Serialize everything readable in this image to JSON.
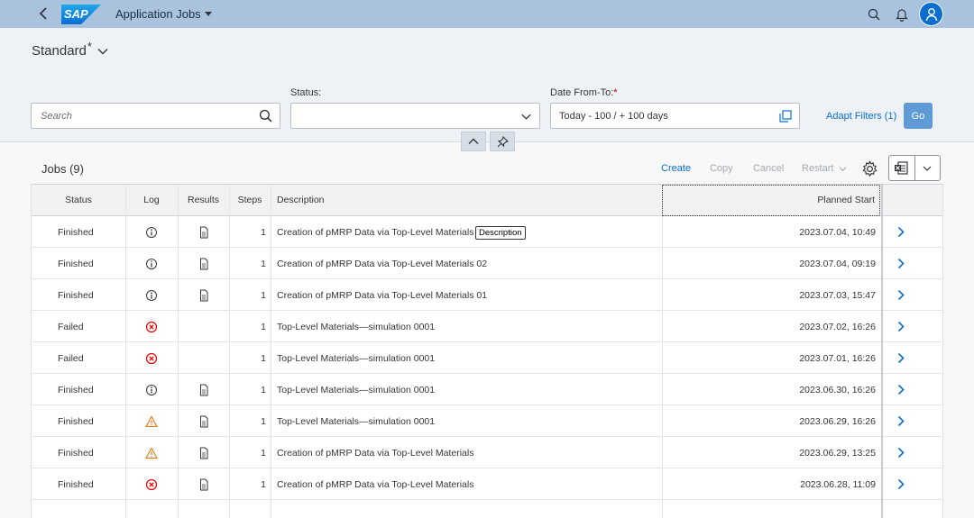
{
  "shell": {
    "app_title": "Application Jobs",
    "logo_text": "SAP"
  },
  "header": {
    "variant_name": "Standard",
    "variant_modified": "*",
    "search_placeholder": "Search",
    "status_label": "Status:",
    "status_value": "",
    "date_label": "Date From-To:",
    "date_required": "*",
    "date_value": "Today - 100 / + 100 days",
    "adapt_filters": "Adapt Filters (1)",
    "go_label": "Go"
  },
  "table": {
    "title": "Jobs (9)",
    "actions": {
      "create": "Create",
      "copy": "Copy",
      "cancel": "Cancel",
      "restart": "Restart"
    },
    "columns": [
      "Status",
      "Log",
      "Results",
      "Steps",
      "Description",
      "Planned Start"
    ],
    "tooltip": "Description",
    "rows": [
      {
        "status": "Finished",
        "log": "info",
        "results": true,
        "steps": "1",
        "description": "Creation of pMRP Data via Top-Level Materials 02",
        "planned_start": "2023.07.04, 10:49"
      },
      {
        "status": "Finished",
        "log": "info",
        "results": true,
        "steps": "1",
        "description": "Creation of pMRP Data via Top-Level Materials 02",
        "planned_start": "2023.07.04, 09:19"
      },
      {
        "status": "Finished",
        "log": "info",
        "results": true,
        "steps": "1",
        "description": "Creation of pMRP Data via Top-Level Materials 01",
        "planned_start": "2023.07.03, 15:47"
      },
      {
        "status": "Failed",
        "log": "error",
        "results": false,
        "steps": "1",
        "description": "Top-Level Materials—simulation 0001",
        "planned_start": "2023.07.02, 16:26"
      },
      {
        "status": "Failed",
        "log": "error",
        "results": false,
        "steps": "1",
        "description": "Top-Level Materials—simulation 0001",
        "planned_start": "2023.07.01, 16:26"
      },
      {
        "status": "Finished",
        "log": "info",
        "results": true,
        "steps": "1",
        "description": "Top-Level Materials—simulation 0001",
        "planned_start": "2023.06.30, 16:26"
      },
      {
        "status": "Finished",
        "log": "warning",
        "results": true,
        "steps": "1",
        "description": "Top-Level Materials—simulation 0001",
        "planned_start": "2023.06.29, 16:26"
      },
      {
        "status": "Finished",
        "log": "warning",
        "results": true,
        "steps": "1",
        "description": "Creation of pMRP Data via Top-Level Materials",
        "planned_start": "2023.06.29, 13:25"
      },
      {
        "status": "Finished",
        "log": "error",
        "results": true,
        "steps": "1",
        "description": "Creation of pMRP Data via Top-Level Materials",
        "planned_start": "2023.06.28, 11:09"
      }
    ]
  },
  "colors": {
    "accent": "#0a6ed1",
    "shell": "#a9c3df",
    "error": "#e00",
    "warning": "#e9730c"
  }
}
